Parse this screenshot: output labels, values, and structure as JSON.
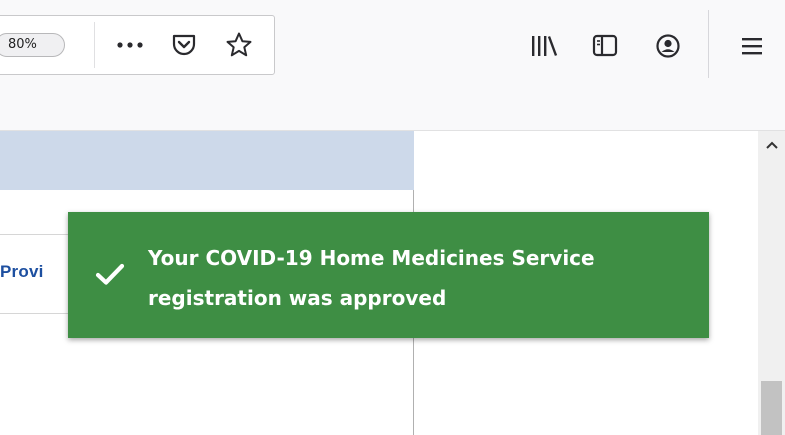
{
  "toolbar": {
    "zoom_level": "80%",
    "icons": {
      "more": "more-actions-icon",
      "pocket": "pocket-icon",
      "bookmark": "bookmark-star-icon",
      "library": "library-icon",
      "sidebar": "sidebar-icon",
      "account": "account-icon",
      "menu": "hamburger-menu-icon"
    }
  },
  "page": {
    "provider_link_text": "Provi"
  },
  "toast": {
    "message": "Your COVID-19 Home Medicines Service registration was approved",
    "color": "#3e8e44",
    "icon": "checkmark-icon"
  }
}
